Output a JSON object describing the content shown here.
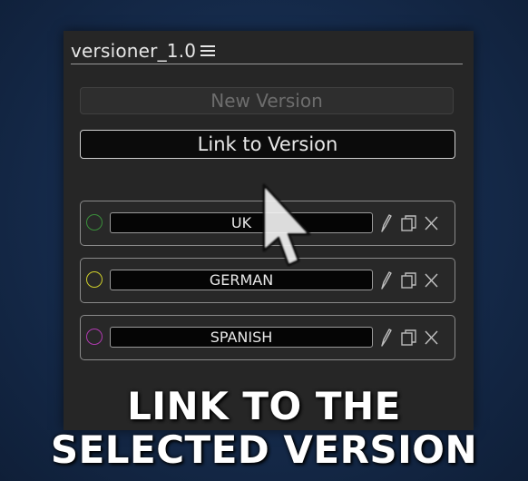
{
  "panel": {
    "title": "versioner_1.0",
    "menu_icon": "hamburger-icon"
  },
  "buttons": {
    "new_version": "New Version",
    "link_to_version": "Link to Version"
  },
  "versions": [
    {
      "name": "UK",
      "color": "#3a8f3a"
    },
    {
      "name": "GERMAN",
      "color": "#cfcf2a"
    },
    {
      "name": "SPANISH",
      "color": "#b03ab0"
    }
  ],
  "row_icons": {
    "edit": "pencil-icon",
    "duplicate": "copy-icon",
    "delete": "close-icon"
  },
  "caption": {
    "line1": "LINK TO THE",
    "line2": "SELECTED VERSION"
  },
  "cursor": "mouse-pointer-icon"
}
